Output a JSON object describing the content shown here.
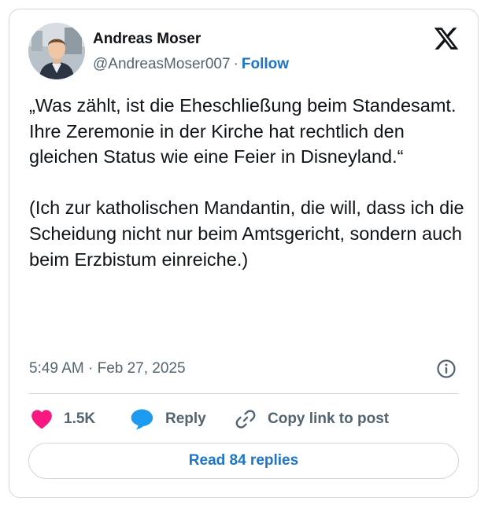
{
  "author": {
    "name": "Andreas Moser",
    "handle": "@AndreasMoser007",
    "separator": "·",
    "follow_label": "Follow"
  },
  "tweet": {
    "text": "„Was zählt, ist die Eheschließung beim Standesamt. Ihre Zeremonie in der Kirche hat rechtlich den gleichen Status wie eine Feier in Disneyland.“\n\n(Ich zur katholischen Mandantin, die will, dass ich die Scheidung nicht nur beim Amtsgericht, sondern auch beim Erzbistum einreiche.)",
    "timestamp": "5:49 AM · Feb 27, 2025"
  },
  "actions": {
    "like_count": "1.5K",
    "reply_label": "Reply",
    "copy_link_label": "Copy link to post"
  },
  "read_replies_label": "Read 84 replies",
  "icons": {
    "logo": "x-logo-icon",
    "info": "info-icon",
    "like": "heart-icon",
    "reply": "speech-bubble-icon",
    "copy_link": "link-icon"
  },
  "colors": {
    "like_heart": "#f91880",
    "reply_bubble": "#1d9bf0",
    "link_blue": "#1d75c9",
    "secondary_text": "#536471",
    "border": "#cfd9de"
  }
}
